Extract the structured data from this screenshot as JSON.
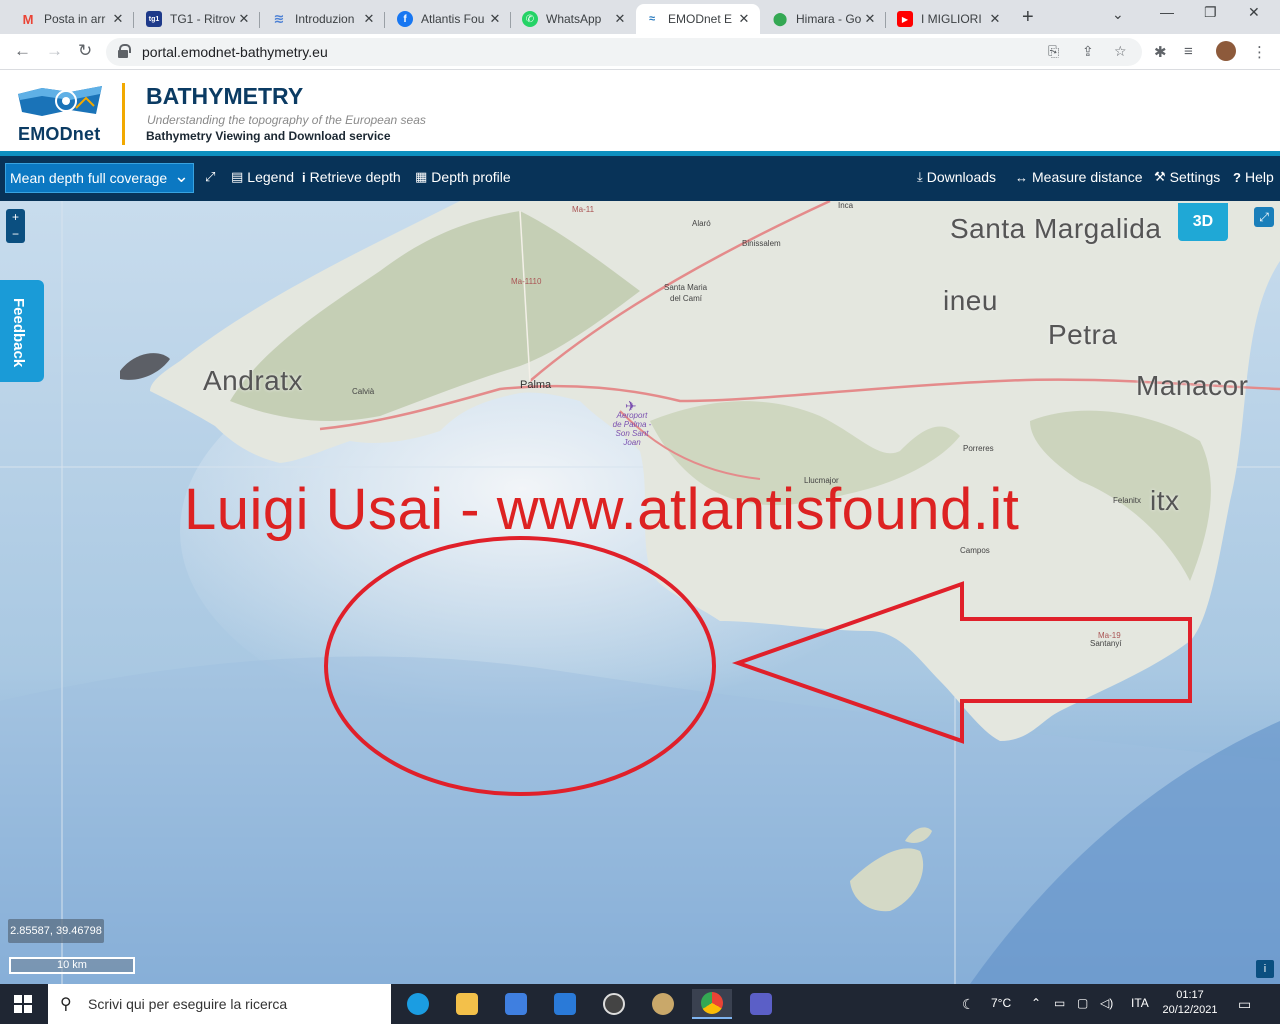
{
  "browser": {
    "tabs": [
      {
        "title": "Posta in arr",
        "icon": "gmail-icon",
        "color": "#ea4335"
      },
      {
        "title": "TG1 - Ritrov",
        "icon": "tg1-icon",
        "color": "#1e3a8a"
      },
      {
        "title": "Introduzion",
        "icon": "page-icon",
        "color": "#4a7fd4"
      },
      {
        "title": "Atlantis Fou",
        "icon": "facebook-icon",
        "color": "#1877f2"
      },
      {
        "title": "WhatsApp",
        "icon": "whatsapp-icon",
        "color": "#25d366"
      },
      {
        "title": "EMODnet E",
        "icon": "emodnet-icon",
        "color": "#2a7bbf"
      },
      {
        "title": "Himara - Go",
        "icon": "maps-icon",
        "color": "#34a853"
      },
      {
        "title": "I MIGLIORI",
        "icon": "youtube-icon",
        "color": "#ff0000"
      }
    ],
    "url": "portal.emodnet-bathymetry.eu"
  },
  "site": {
    "logo_text": "EMODnet",
    "title": "BATHYMETRY",
    "subtitle": "Understanding the topography of the European seas",
    "service": "Bathymetry Viewing and Download service"
  },
  "toolbar": {
    "layer": "Mean depth full coverage",
    "legend": "Legend",
    "retrieve_depth": "Retrieve depth",
    "depth_profile": "Depth profile",
    "downloads": "Downloads",
    "measure_distance": "Measure distance",
    "settings": "Settings",
    "help": "Help"
  },
  "map": {
    "zoom_in": "+",
    "zoom_out": "−",
    "feedback": "Feedback",
    "btn_3d": "3D",
    "coords": "2.85587, 39.46798",
    "scale": "10 km",
    "watermark": "Luigi Usai - www.atlantisfound.it",
    "places": {
      "santa_margalida": "Santa Margalida",
      "ineu": "ineu",
      "petra": "Petra",
      "manacor": "Manacor",
      "andratx": "Andratx",
      "itx": "itx",
      "palma": "Palma",
      "calvia": "Calvià",
      "alaro": "Alaró",
      "binissalem": "Binissalem",
      "inca": "Inca",
      "santa_maria": "Santa Maria",
      "del_cami": "del Camí",
      "porreres": "Porreres",
      "llucmajor": "Llucmajor",
      "felanitx": "Felanitx",
      "campos": "Campos",
      "santanyi": "Santanyí",
      "airport": "Aeroport de Palma - Son Sant Joan",
      "ma11": "Ma-11",
      "ma1110": "Ma-1110",
      "ma19": "Ma-19"
    }
  },
  "taskbar": {
    "search_placeholder": "Scrivi qui per eseguire la ricerca",
    "weather": "7°C",
    "lang": "ITA",
    "time": "01:17",
    "date": "20/12/2021"
  }
}
